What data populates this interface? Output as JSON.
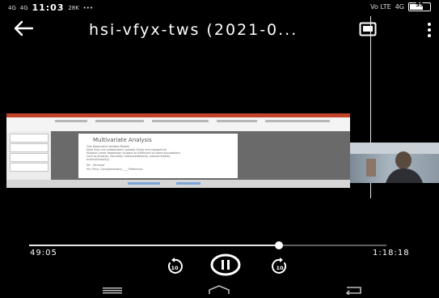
{
  "status_bar": {
    "signal_1": "4G",
    "signal_2": "4G",
    "time": "11:03",
    "data_speed": "28K",
    "extra_dots": "•••",
    "volte_label": "Vo LTE",
    "network_label": "4G",
    "battery_percent": "59"
  },
  "header": {
    "title": "hsi-vfyx-tws (2021-0...",
    "icons": [
      "back-arrow-icon",
      "picture-in-picture-icon",
      "more-vertical-icon"
    ]
  },
  "video": {
    "slide_title": "Multivariate Analysis",
    "slide_bullets": [
      "One Dependent Variable Models",
      "More than one independent variable (Scale and categorical)",
      "Multiple Linear Regression (subject to fulfillment of some assumptions",
      "such as linearity, normality, homoscedasticity, autocorrelation,",
      "multicollinearity)",
      "DV - Demand",
      "IVs: Price, Complementary, ___ Preference"
    ]
  },
  "playback": {
    "current_time": "49:05",
    "total_time": "1:18:18",
    "progress_fraction": 0.7
  },
  "controls": {
    "rewind_icon": "rewind-10-icon",
    "play_pause_icon": "pause-icon",
    "forward_icon": "forward-10-icon"
  },
  "nav_bar": {
    "icons": [
      "recent-apps-icon",
      "home-icon",
      "back-icon"
    ]
  },
  "colors": {
    "background": "#000000",
    "accent_ppt": "#c1432a",
    "progress_played": "#e8e8e8",
    "progress_track": "#5f5f5f"
  }
}
